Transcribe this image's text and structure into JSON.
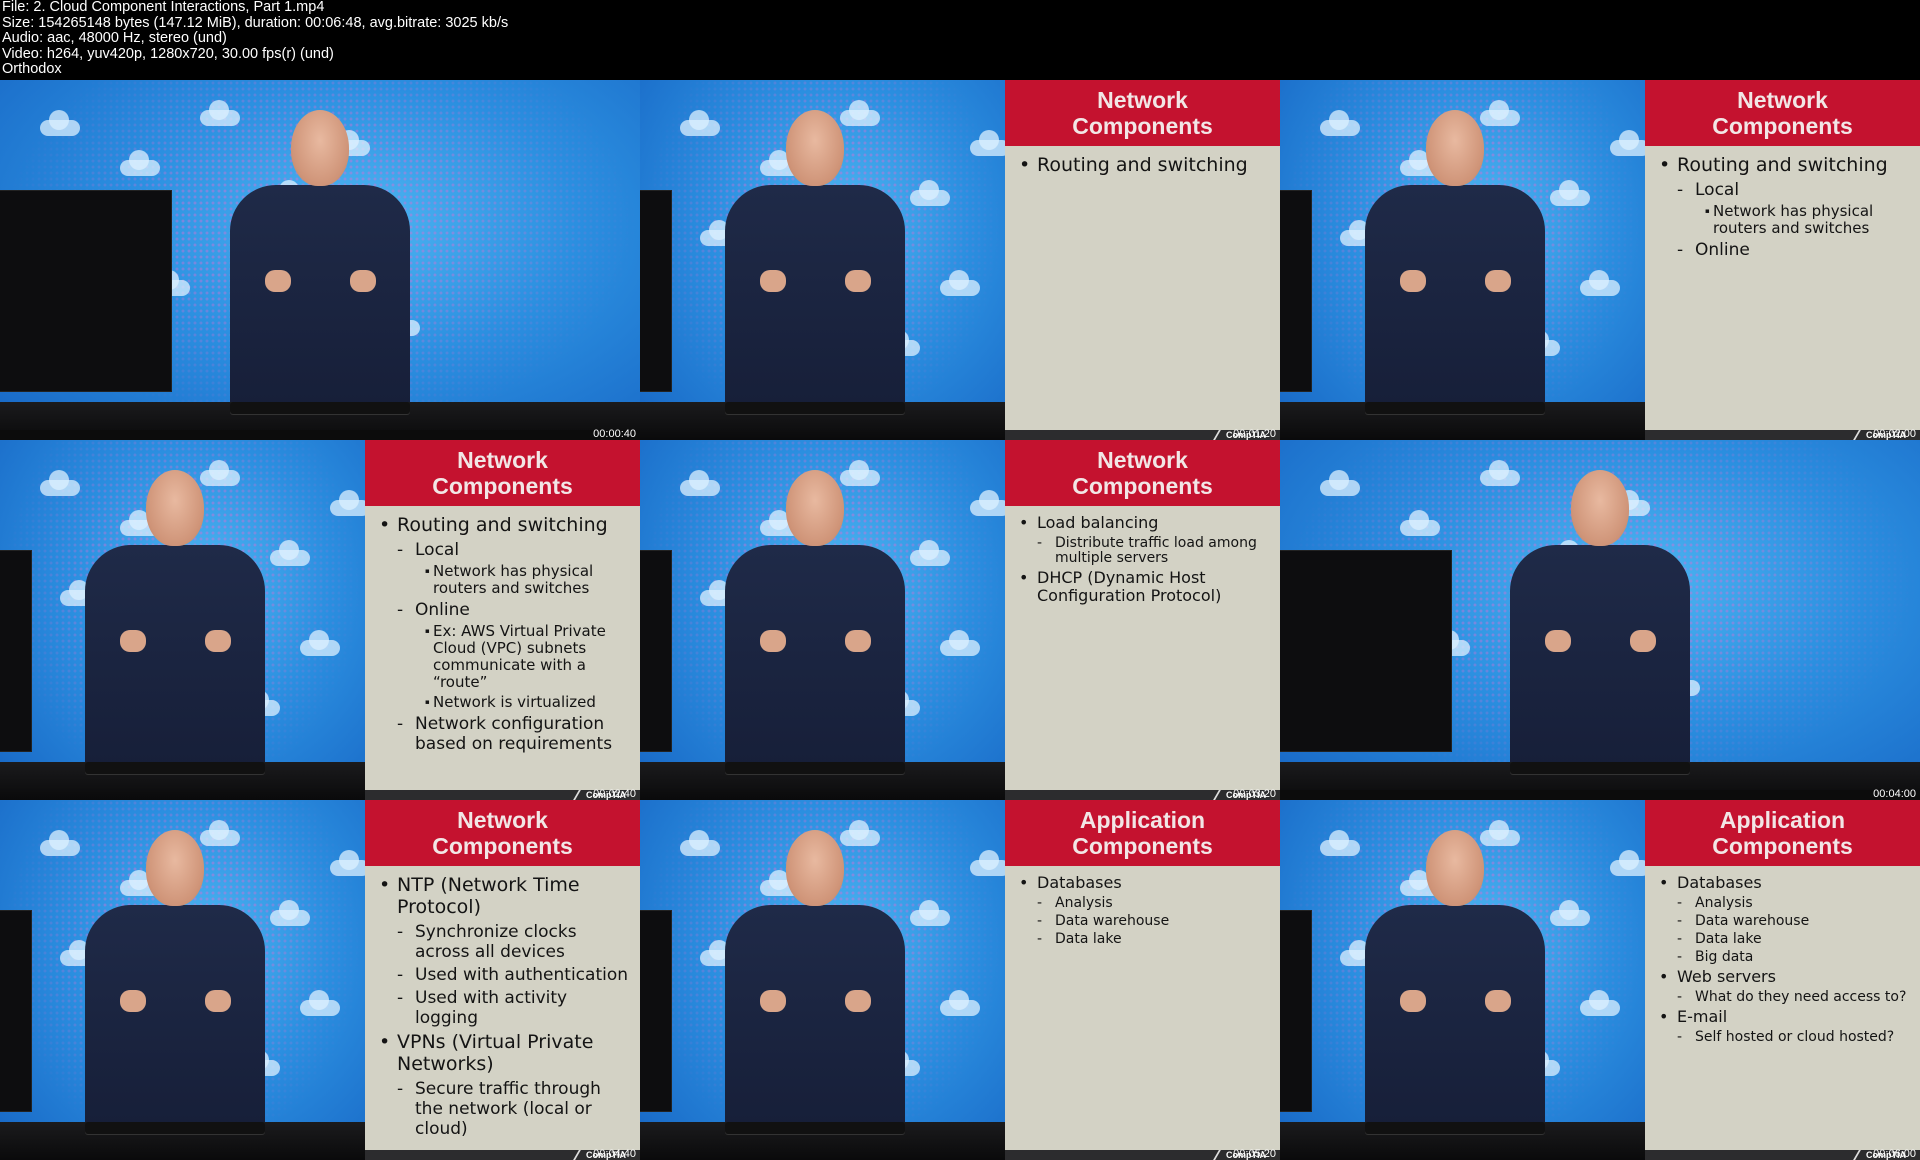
{
  "file_info": {
    "file": "File: 2. Cloud Component Interactions, Part 1.mp4",
    "size": "Size: 154265148 bytes (147.12 MiB), duration: 00:06:48, avg.bitrate: 3025 kb/s",
    "audio": "Audio: aac, 48000 Hz, stereo (und)",
    "video": "Video: h264, yuv420p, 1280x720, 30.00 fps(r) (und)",
    "label": "Orthodox"
  },
  "slide_brand": "CompTIA",
  "colors": {
    "slide_header": "#c4122f",
    "slide_body": "#d3d2c5",
    "backdrop": "#2b8fe0"
  },
  "frames": [
    {
      "timestamp": "00:00:40",
      "slide": null
    },
    {
      "timestamp": "00:01:20",
      "slide": {
        "title": [
          "Network",
          "Components"
        ],
        "items": [
          {
            "level": 1,
            "text": "Routing and switching"
          }
        ]
      }
    },
    {
      "timestamp": "00:02:00",
      "slide": {
        "title": [
          "Network",
          "Components"
        ],
        "items": [
          {
            "level": 1,
            "text": "Routing and switching"
          },
          {
            "level": 2,
            "text": "Local"
          },
          {
            "level": 3,
            "text": "Network has physical routers and switches"
          },
          {
            "level": 2,
            "text": "Online"
          }
        ]
      }
    },
    {
      "timestamp": "00:02:40",
      "slide": {
        "title": [
          "Network",
          "Components"
        ],
        "items": [
          {
            "level": 1,
            "text": "Routing and switching"
          },
          {
            "level": 2,
            "text": "Local"
          },
          {
            "level": 3,
            "text": "Network has physical routers and switches"
          },
          {
            "level": 2,
            "text": "Online"
          },
          {
            "level": 3,
            "text": "Ex: AWS Virtual Private Cloud (VPC) subnets communicate with a “route”"
          },
          {
            "level": 3,
            "text": "Network is virtualized"
          },
          {
            "level": 2,
            "text": "Network configuration based on requirements"
          }
        ]
      }
    },
    {
      "timestamp": "00:03:20",
      "slide": {
        "title": [
          "Network",
          "Components"
        ],
        "small": true,
        "items": [
          {
            "level": 1,
            "text": "Load balancing"
          },
          {
            "level": 2,
            "text": "Distribute traffic load among multiple servers"
          },
          {
            "level": 1,
            "text": "DHCP (Dynamic Host Configuration Protocol)"
          }
        ]
      }
    },
    {
      "timestamp": "00:04:00",
      "slide": null
    },
    {
      "timestamp": "00:04:40",
      "slide": {
        "title": [
          "Network",
          "Components"
        ],
        "items": [
          {
            "level": 1,
            "text": "NTP (Network Time Protocol)"
          },
          {
            "level": 2,
            "text": "Synchronize clocks across all devices"
          },
          {
            "level": 2,
            "text": "Used with authentication"
          },
          {
            "level": 2,
            "text": "Used with activity logging"
          },
          {
            "level": 1,
            "text": "VPNs (Virtual Private Networks)"
          },
          {
            "level": 2,
            "text": "Secure traffic through the network (local or cloud)"
          }
        ]
      }
    },
    {
      "timestamp": "00:05:20",
      "slide": {
        "title": [
          "Application",
          "Components"
        ],
        "small": true,
        "items": [
          {
            "level": 1,
            "text": "Databases"
          },
          {
            "level": 2,
            "text": "Analysis"
          },
          {
            "level": 2,
            "text": "Data warehouse"
          },
          {
            "level": 2,
            "text": "Data lake"
          }
        ]
      }
    },
    {
      "timestamp": "00:06:00",
      "slide": {
        "title": [
          "Application",
          "Components"
        ],
        "small": true,
        "items": [
          {
            "level": 1,
            "text": "Databases"
          },
          {
            "level": 2,
            "text": "Analysis"
          },
          {
            "level": 2,
            "text": "Data warehouse"
          },
          {
            "level": 2,
            "text": "Data lake"
          },
          {
            "level": 2,
            "text": "Big data"
          },
          {
            "level": 1,
            "text": "Web servers"
          },
          {
            "level": 2,
            "text": "What do they need access to?"
          },
          {
            "level": 1,
            "text": "E-mail"
          },
          {
            "level": 2,
            "text": "Self hosted or cloud hosted?"
          }
        ]
      }
    }
  ]
}
